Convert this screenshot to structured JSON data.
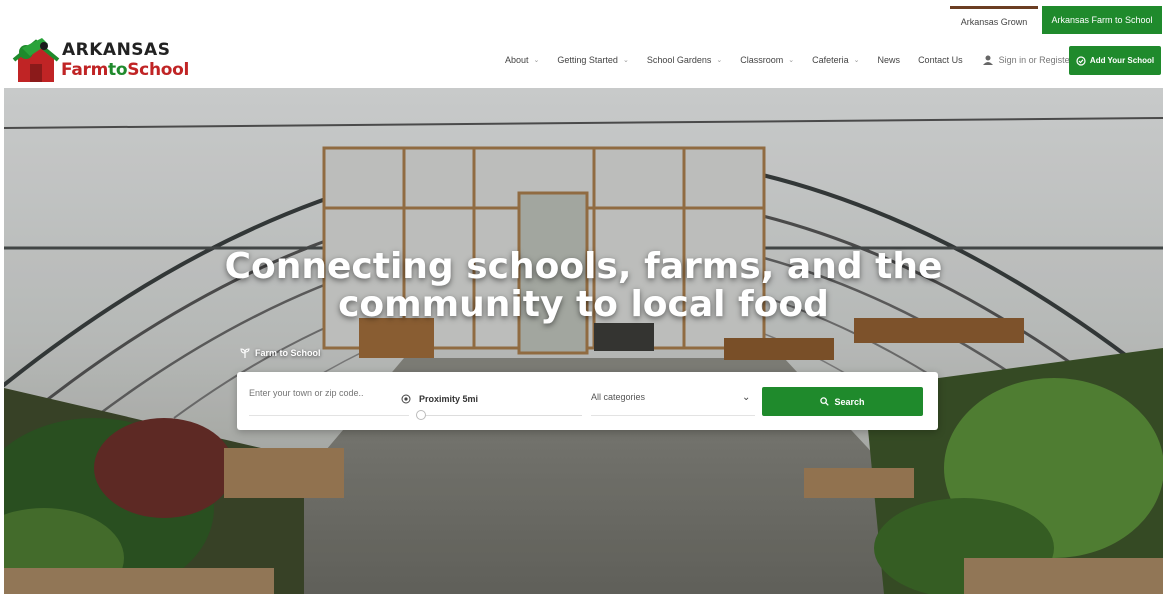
{
  "topbar": {
    "link_grown": "Arkansas Grown",
    "link_f2s": "Arkansas Farm to School"
  },
  "logo": {
    "line1": "ARKANSAS",
    "line2_farm": "Farm",
    "line2_to": "to",
    "line2_school": "School"
  },
  "nav": {
    "items": [
      {
        "label": "About",
        "dropdown": true
      },
      {
        "label": "Getting Started",
        "dropdown": true
      },
      {
        "label": "School Gardens",
        "dropdown": true
      },
      {
        "label": "Classroom",
        "dropdown": true
      },
      {
        "label": "Cafeteria",
        "dropdown": true
      },
      {
        "label": "News",
        "dropdown": false
      },
      {
        "label": "Contact Us",
        "dropdown": false
      }
    ],
    "signin": "Sign in or Register",
    "add_school": "Add Your School"
  },
  "hero": {
    "title_line1": "Connecting schools, farms, and the",
    "title_line2": "community to local food",
    "tag": "Farm to School"
  },
  "search": {
    "location_placeholder": "Enter your town or zip code..",
    "proximity_label": "Proximity 5mi",
    "proximity_value": 5,
    "category": "All categories",
    "button": "Search"
  },
  "colors": {
    "brand_green": "#1f8a2c",
    "brand_red": "#c02425",
    "accent_brown": "#6b3d22"
  },
  "icons": {
    "user": "user-icon",
    "add_school": "location-check-icon",
    "tag": "sprout-icon",
    "proximity": "target-icon",
    "search": "search-icon",
    "category_chevron": "chevron-down-icon"
  }
}
